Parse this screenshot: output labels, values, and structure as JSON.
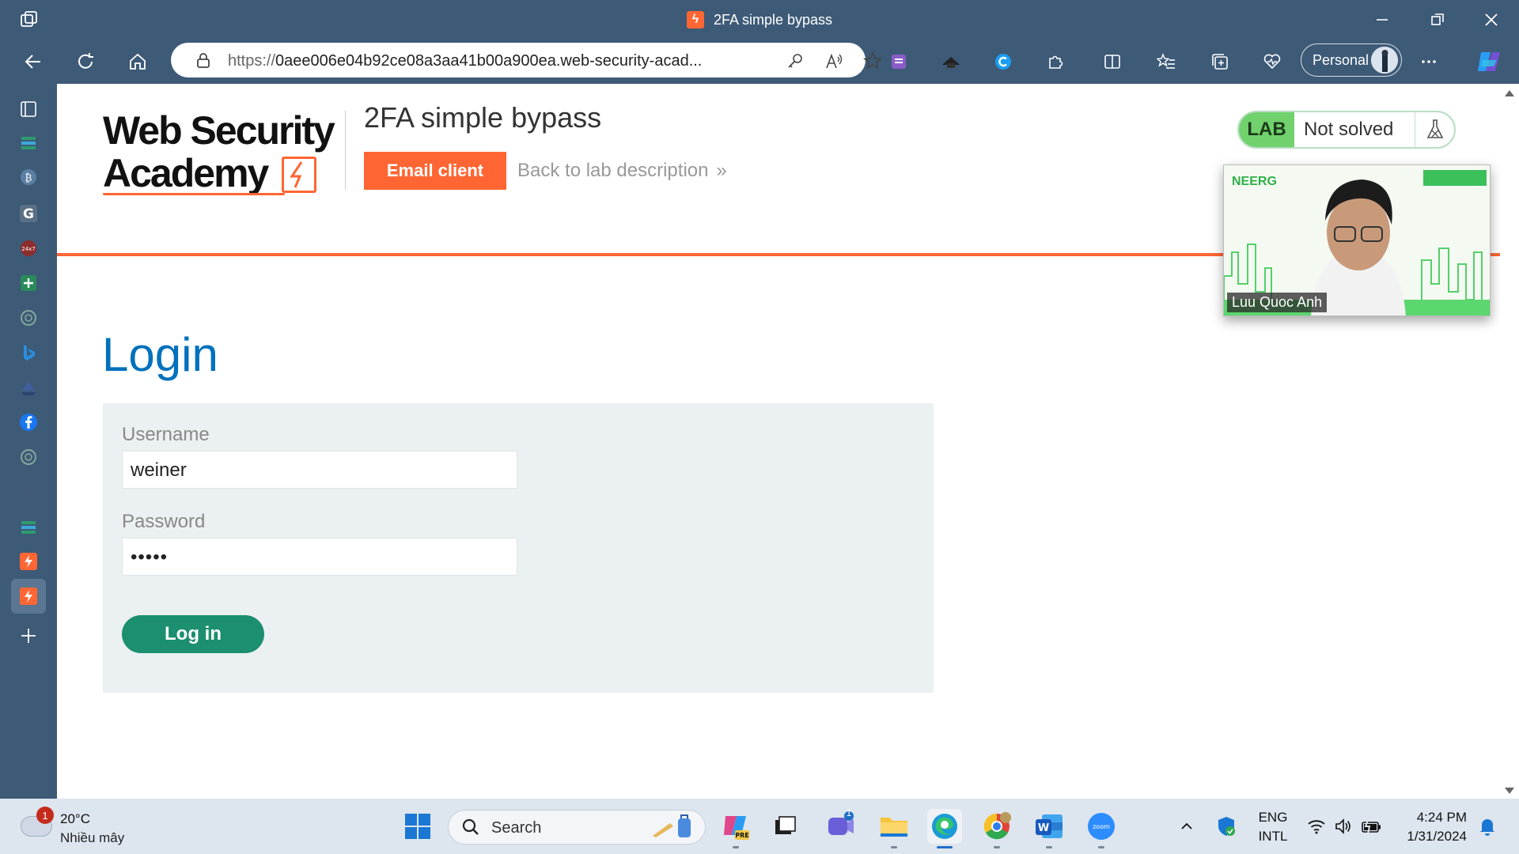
{
  "window": {
    "tab_title": "2FA simple bypass"
  },
  "toolbar": {
    "url_proto": "https://",
    "url_rest": "0aee006e04b92ce08a3aa41b00a900ea.web-security-acad...",
    "profile_label": "Personal"
  },
  "page": {
    "logo_line1": "Web Security",
    "logo_line2": "Academy",
    "lab_title": "2FA simple bypass",
    "email_client_label": "Email client",
    "back_link_label": "Back to lab description",
    "back_link_chevron": "»",
    "lab_badge_label": "LAB",
    "lab_status": "Not solved",
    "login_heading": "Login",
    "username_label": "Username",
    "username_value": "weiner",
    "password_label": "Password",
    "password_value": "•••••",
    "login_button_label": "Log in",
    "accent_color": "#ff6633",
    "heading_color": "#0071bc",
    "button_color": "#1b8f6f"
  },
  "video": {
    "participant_name": "Luu Quoc Anh"
  },
  "taskbar": {
    "weather_temp": "20°C",
    "weather_desc": "Nhiều mây",
    "weather_badge": "1",
    "search_label": "Search",
    "teams_badge": "1",
    "lang_line1": "ENG",
    "lang_line2": "INTL",
    "time": "4:24 PM",
    "date": "1/31/2024"
  }
}
